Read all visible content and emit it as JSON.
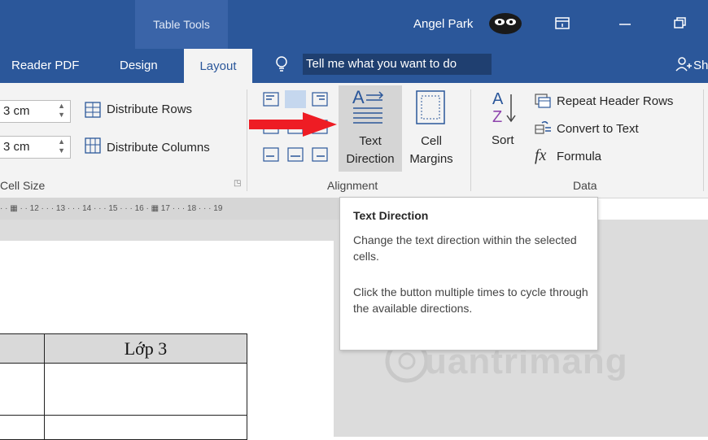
{
  "title_bar": {
    "table_tools": "Table Tools",
    "user_name": "Angel Park"
  },
  "tabs": {
    "reader_pdf": "Reader PDF",
    "design": "Design",
    "layout": "Layout",
    "tell_me": "Tell me what you want to do",
    "share": "Sh"
  },
  "ribbon": {
    "cell_size": {
      "height_value": "3 cm",
      "width_value": "3 cm",
      "distribute_rows": "Distribute Rows",
      "distribute_columns": "Distribute Columns",
      "group_label": "Cell Size"
    },
    "alignment": {
      "text_direction_line1": "Text",
      "text_direction_line2": "Direction",
      "cell_margins_line1": "Cell",
      "cell_margins_line2": "Margins",
      "group_label": "Alignment"
    },
    "data": {
      "sort": "Sort",
      "repeat_header_rows": "Repeat Header Rows",
      "convert_to_text": "Convert to Text",
      "formula": "Formula",
      "group_label": "Data"
    }
  },
  "ruler": {
    "text": "· · ▦ · · 12 · · · 13 · · · 14 · · · 15 · · · 16 · ▦ 17 · · · 18 · · · 19"
  },
  "tooltip": {
    "title": "Text Direction",
    "line1": "Change the text direction within the selected cells.",
    "line2": "Click the button multiple times to cycle through the available directions."
  },
  "document": {
    "table_header": "Lớp 3"
  },
  "watermark": {
    "text": "uantrimang"
  }
}
